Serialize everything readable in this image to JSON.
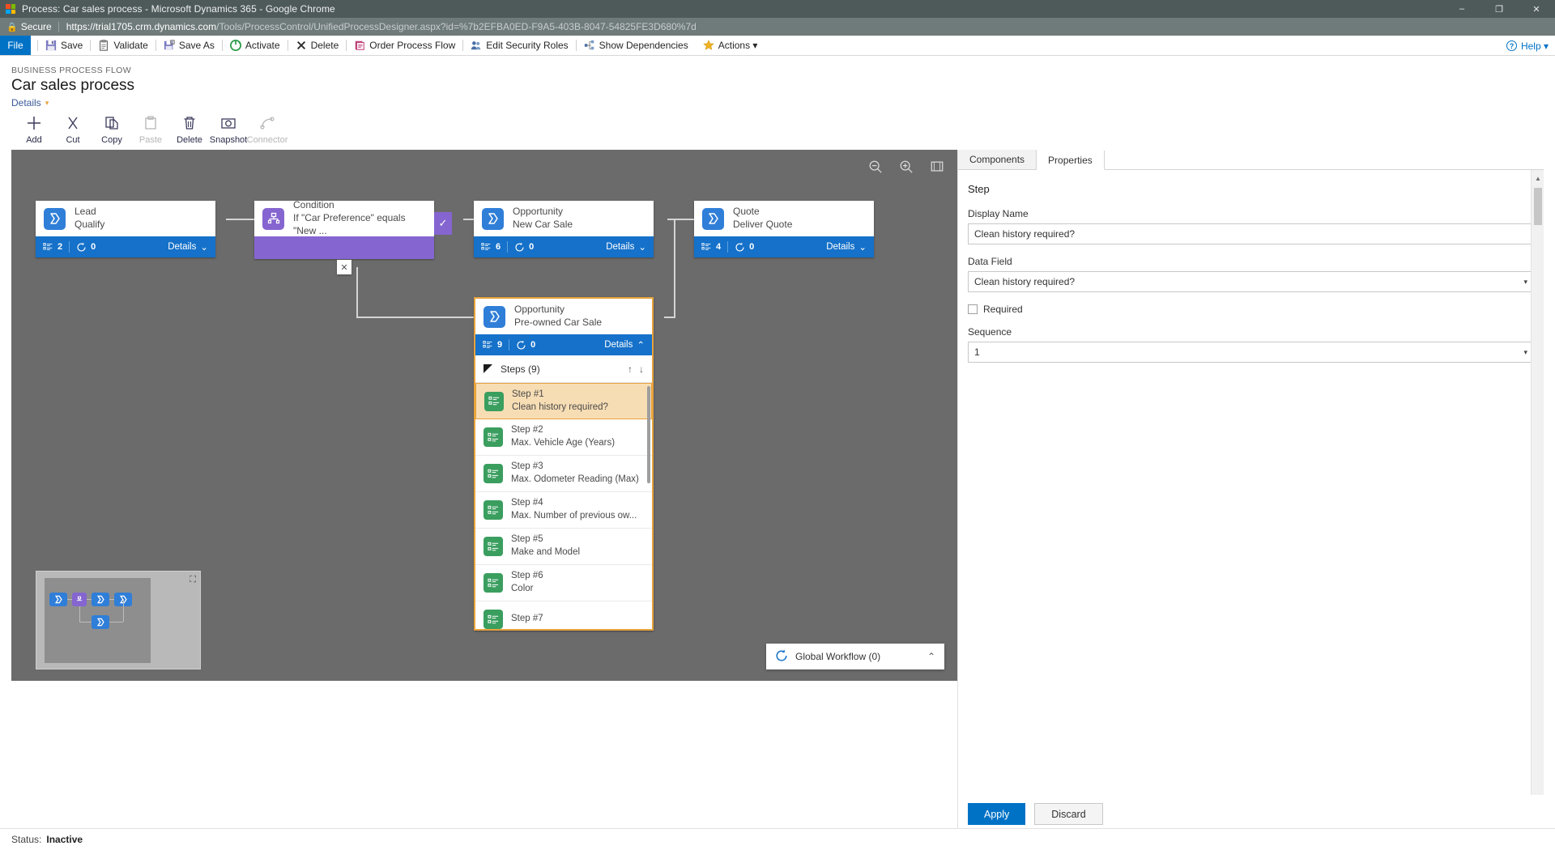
{
  "browser": {
    "window_title": "Process: Car sales process - Microsoft Dynamics 365 - Google Chrome",
    "secure_label": "Secure",
    "url_host": "https://trial1705.crm.dynamics.com",
    "url_path": "/Tools/ProcessControl/UnifiedProcessDesigner.aspx?id=%7b2EFBA0ED-F9A5-403B-8047-54825FE3D680%7d",
    "minimize": "–",
    "maximize": "❐",
    "close": "✕"
  },
  "ribbon": {
    "file_label": "File",
    "items": [
      {
        "label": "Save",
        "icon": "save-icon"
      },
      {
        "label": "Validate",
        "icon": "validate-icon"
      },
      {
        "label": "Save As",
        "icon": "save-as-icon"
      },
      {
        "label": "Activate",
        "icon": "activate-icon"
      },
      {
        "label": "Delete",
        "icon": "delete-icon"
      },
      {
        "label": "Order Process Flow",
        "icon": "order-process-flow-icon"
      },
      {
        "label": "Edit Security Roles",
        "icon": "security-roles-icon"
      },
      {
        "label": "Show Dependencies",
        "icon": "dependencies-icon"
      },
      {
        "label": "Actions ▾",
        "icon": "actions-icon"
      }
    ],
    "help_label": "Help ▾"
  },
  "page": {
    "eyebrow": "BUSINESS PROCESS FLOW",
    "title": "Car sales process",
    "details_label": "Details",
    "details_caret": "▾"
  },
  "commandbar": {
    "items": [
      {
        "label": "Add",
        "icon": "plus-icon",
        "disabled": false
      },
      {
        "label": "Cut",
        "icon": "scissors-icon",
        "disabled": false
      },
      {
        "label": "Copy",
        "icon": "copy-icon",
        "disabled": false
      },
      {
        "label": "Paste",
        "icon": "paste-icon",
        "disabled": true
      },
      {
        "label": "Delete",
        "icon": "trash-icon",
        "disabled": false
      },
      {
        "label": "Snapshot",
        "icon": "camera-icon",
        "disabled": false
      },
      {
        "label": "Connector",
        "icon": "connector-icon",
        "disabled": true
      }
    ]
  },
  "canvas": {
    "tools": [
      {
        "name": "zoom-out-icon",
        "glyph": "⊖"
      },
      {
        "name": "zoom-in-icon",
        "glyph": "⊕"
      },
      {
        "name": "fit-to-screen-icon",
        "glyph": "⛶"
      }
    ],
    "stages": [
      {
        "entity": "Lead",
        "name": "Qualify",
        "steps": "2",
        "workflows": "0",
        "details": "Details",
        "chevron": "⌄",
        "type": "stage"
      },
      {
        "entity": "Condition",
        "name": "If \"Car Preference\" equals \"New ...",
        "type": "condition",
        "check": "✓",
        "close": "✕"
      },
      {
        "entity": "Opportunity",
        "name": "New Car Sale",
        "steps": "6",
        "workflows": "0",
        "details": "Details",
        "chevron": "⌄",
        "type": "stage"
      },
      {
        "entity": "Quote",
        "name": "Deliver Quote",
        "steps": "4",
        "workflows": "0",
        "details": "Details",
        "chevron": "⌄",
        "type": "stage"
      },
      {
        "entity": "Opportunity",
        "name": "Pre-owned Car Sale",
        "steps": "9",
        "workflows": "0",
        "details": "Details",
        "chevron": "⌃",
        "type": "stage-selected"
      }
    ],
    "steps_panel": {
      "header": "Steps (9)",
      "move_up": "↑",
      "move_down": "↓",
      "steps": [
        {
          "number": "Step #1",
          "label": "Clean history required?",
          "active": true
        },
        {
          "number": "Step #2",
          "label": "Max. Vehicle Age (Years)",
          "active": false
        },
        {
          "number": "Step #3",
          "label": "Max. Odometer Reading (Max)",
          "active": false
        },
        {
          "number": "Step #4",
          "label": "Max. Number of previous ow...",
          "active": false
        },
        {
          "number": "Step #5",
          "label": "Make and Model",
          "active": false
        },
        {
          "number": "Step #6",
          "label": "Color",
          "active": false
        },
        {
          "number": "Step #7",
          "label": "",
          "active": false
        }
      ]
    },
    "global_workflow": {
      "label": "Global Workflow (0)",
      "chevron": "⌃",
      "icon": "workflow-icon"
    },
    "minimap": {
      "icon": "expand-minimap-icon",
      "glyph": "⛶"
    }
  },
  "properties": {
    "tabs": [
      {
        "label": "Components",
        "active": false
      },
      {
        "label": "Properties",
        "active": true
      }
    ],
    "section_title": "Step",
    "fields": {
      "display_name_label": "Display Name",
      "display_name_value": "Clean history required?",
      "data_field_label": "Data Field",
      "data_field_value": "Clean history required?",
      "required_label": "Required",
      "required_checked": false,
      "sequence_label": "Sequence",
      "sequence_value": "1",
      "select_arrow": "▾"
    },
    "apply_label": "Apply",
    "discard_label": "Discard"
  },
  "statusbar": {
    "label": "Status:",
    "value": "Inactive"
  },
  "colors": {
    "accent_blue": "#0072c6",
    "stage_blue": "#1571c9",
    "condition_purple": "#8565d0",
    "step_green": "#3a9e5f",
    "selection_orange": "#e8a33d",
    "canvas_gray": "#6b6b6b"
  }
}
